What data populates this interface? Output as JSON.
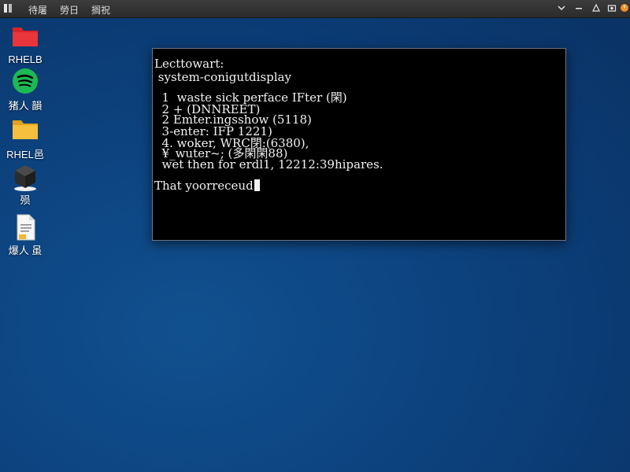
{
  "top_panel": {
    "menus": [
      "待屠",
      "勞日",
      "搁祝"
    ],
    "tray_icons": [
      "chevron-down-icon",
      "network-icon",
      "power-icon"
    ]
  },
  "desktop": {
    "icons": [
      {
        "name": "rhel-folder-red",
        "label": "RHELB",
        "icon": "folder-icon",
        "color": "#d8232a"
      },
      {
        "name": "spotify",
        "label": "猪人 韻",
        "icon": "spotify-icon",
        "color": "#1db954"
      },
      {
        "name": "rhel-folder",
        "label": "RHEL邑",
        "icon": "folder-icon",
        "color": "#f2b735"
      },
      {
        "name": "package",
        "label": "殒",
        "icon": "package-icon",
        "color": "#2a2a2a"
      },
      {
        "name": "document",
        "label": "爆人 虽",
        "icon": "document-icon",
        "color": "#f5f5f5"
      }
    ]
  },
  "terminal": {
    "lines": [
      "Lecttowart:",
      " system-conigutdisplay",
      "  1  waste sick perface IFter (閑)",
      "  2 + (DNNREET)",
      "  2 Emter.ingsshow (5118)",
      "  3-enter: IFP 1221)",
      "  4. woker, WRC閉:(6380),",
      "  ¥_wuter~; (多閑閑88)",
      "  wet then for erdl1, 12212:39hipares.",
      "That yoorreceud"
    ]
  }
}
